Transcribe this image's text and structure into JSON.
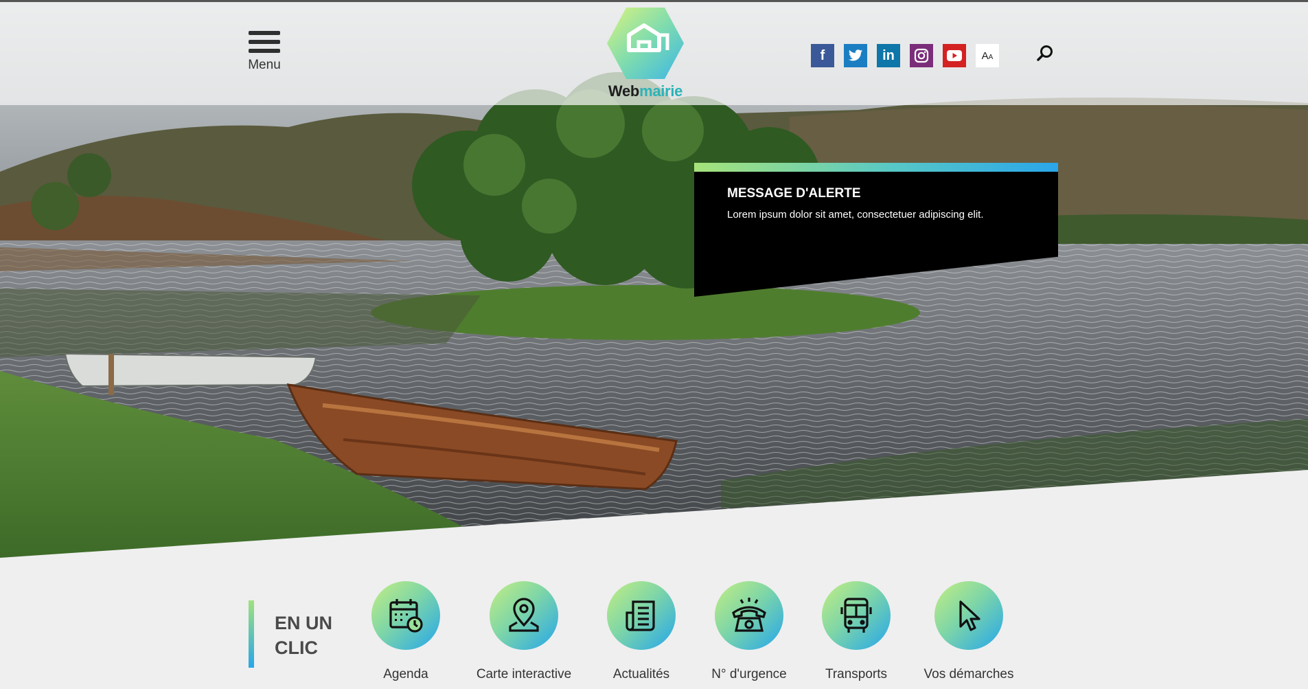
{
  "header": {
    "menu_label": "Menu",
    "logo": {
      "word_dark": "Web",
      "word_accent": "mairie",
      "icon": "house-icon"
    },
    "social": [
      {
        "name": "facebook",
        "icon": "facebook-icon",
        "glyph": "f"
      },
      {
        "name": "twitter",
        "icon": "twitter-icon"
      },
      {
        "name": "linkedin",
        "icon": "linkedin-icon",
        "glyph": "in"
      },
      {
        "name": "instagram",
        "icon": "instagram-icon"
      },
      {
        "name": "youtube",
        "icon": "youtube-icon"
      },
      {
        "name": "text-size",
        "icon": "text-size-icon",
        "glyph_big": "A",
        "glyph_small": "A"
      }
    ],
    "search_icon": "search-icon"
  },
  "alert": {
    "title": "MESSAGE D'ALERTE",
    "text": "Lorem ipsum dolor sit amet, consectetuer adipiscing elit."
  },
  "quick_links": {
    "heading": "EN UN CLIC",
    "items": [
      {
        "label": "Agenda",
        "icon": "calendar-clock-icon"
      },
      {
        "label": "Carte interactive",
        "icon": "map-pin-icon"
      },
      {
        "label": "Actualités",
        "icon": "newspaper-icon"
      },
      {
        "label": "N° d'urgence",
        "icon": "phone-alarm-icon"
      },
      {
        "label": "Transports",
        "icon": "bus-icon"
      },
      {
        "label": "Vos démarches",
        "icon": "cursor-pointer-icon"
      }
    ]
  },
  "colors": {
    "brand_teal": "#2bb3b8",
    "gradient_green": "#a6e37a",
    "gradient_blue": "#2aa6ea",
    "alert_bg": "#000000"
  }
}
